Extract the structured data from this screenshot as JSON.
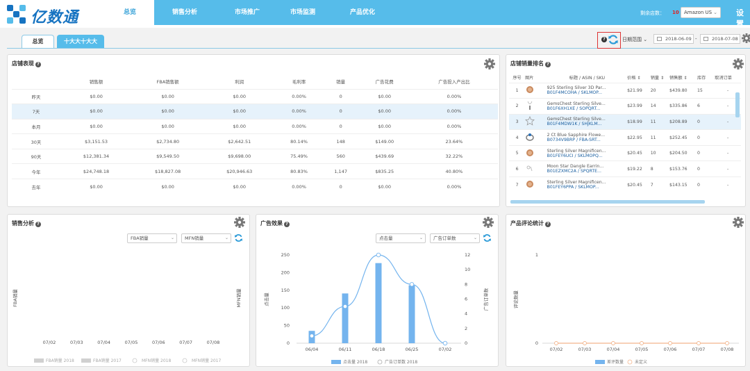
{
  "brand": {
    "name": "亿数通"
  },
  "nav": {
    "tabs": [
      "总览",
      "销售分析",
      "市场推广",
      "市场监测",
      "产品优化"
    ],
    "remaining_label": "剩余店数：",
    "remaining_count": "10",
    "store_selected": "Amazon US",
    "settings": "设置"
  },
  "subtabs": [
    "总览",
    "十大大十大大"
  ],
  "toolbar": {
    "help": "?",
    "date_range_label": "日期范围",
    "date_start": "2018-06-09",
    "date_end": "2018-07-08",
    "date_sep": "-"
  },
  "store_perf": {
    "title": "店铺表现",
    "columns": [
      "",
      "销售额",
      "FBA销售额",
      "利润",
      "毛利率",
      "销量",
      "广告花费",
      "广告投入产出比"
    ],
    "rows": [
      [
        "昨天",
        "$0.00",
        "$0.00",
        "$0.00",
        "0.00%",
        "0",
        "$0.00",
        "0.00%"
      ],
      [
        "7天",
        "$0.00",
        "$0.00",
        "$0.00",
        "0.00%",
        "0",
        "$0.00",
        "0.00%"
      ],
      [
        "本月",
        "$0.00",
        "$0.00",
        "$0.00",
        "0.00%",
        "0",
        "$0.00",
        "0.00%"
      ],
      [
        "30天",
        "$3,151.53",
        "$2,734.80",
        "$2,642.51",
        "80.14%",
        "148",
        "$149.00",
        "23.64%"
      ],
      [
        "90天",
        "$12,381.34",
        "$9,549.50",
        "$9,698.00",
        "75.49%",
        "560",
        "$439.69",
        "32.22%"
      ],
      [
        "今年",
        "$24,748.18",
        "$18,827.08",
        "$20,946.63",
        "80.83%",
        "1,147",
        "$835.25",
        "40.80%"
      ],
      [
        "去年",
        "$0.00",
        "$0.00",
        "$0.00",
        "0.00%",
        "0",
        "$0.00",
        "0.00%"
      ]
    ]
  },
  "rank": {
    "title": "店铺销量排名",
    "columns": [
      "序号",
      "图片",
      "标题 / ASIN / SKU",
      "价格 ⇕",
      "销量 ⇕",
      "销售额 ⇕",
      "库存",
      "取消订单"
    ],
    "rows": [
      {
        "n": "1",
        "title": "925 Sterling Silver 3D Par...",
        "sub": "B01F4MCOHA / SKLMOP...",
        "price": "$21.99",
        "qty": "20",
        "sales": "$439.80",
        "stock": "15",
        "cancel": "-",
        "stock_red": false,
        "icon": "pendant-icon"
      },
      {
        "n": "2",
        "title": "GemsChest Sterling Silve...",
        "sub": "B01F6XH1XE / SOPQRT...",
        "price": "$23.99",
        "qty": "14",
        "sales": "$335.86",
        "stock": "6",
        "cancel": "-",
        "stock_red": true,
        "icon": "necklace-icon"
      },
      {
        "n": "3",
        "title": "GemsChest Sterling Silve...",
        "sub": "B01F4MDW1K / SHJKLM...",
        "price": "$18.99",
        "qty": "11",
        "sales": "$208.89",
        "stock": "0",
        "cancel": "-",
        "stock_red": true,
        "icon": "star-pendant-icon"
      },
      {
        "n": "4",
        "title": "2 Ct Blue Sapphire Flowe...",
        "sub": "B0734V9BRP / FBA-SRT...",
        "price": "$22.95",
        "qty": "11",
        "sales": "$252.45",
        "stock": "0",
        "cancel": "-",
        "stock_red": true,
        "icon": "ring-icon"
      },
      {
        "n": "5",
        "title": "Sterling Silver Magnificen...",
        "sub": "B01FEY6UCI / SKLMOPQ...",
        "price": "$20.45",
        "qty": "10",
        "sales": "$204.50",
        "stock": "0",
        "cancel": "-",
        "stock_red": true,
        "icon": "pendant-icon"
      },
      {
        "n": "6",
        "title": "Moon Star Dangle Earrin...",
        "sub": "B01EZXMC2A / SPQRTE...",
        "price": "$19.22",
        "qty": "8",
        "sales": "$153.76",
        "stock": "0",
        "cancel": "-",
        "stock_red": true,
        "icon": "earring-icon"
      },
      {
        "n": "7",
        "title": "Sterling Silver Magnificen...",
        "sub": "B01FEY6PPA / SKLMOP...",
        "price": "$20.45",
        "qty": "7",
        "sales": "$143.15",
        "stock": "0",
        "cancel": "-",
        "stock_red": true,
        "icon": "pendant-icon"
      }
    ]
  },
  "sales_analysis": {
    "title": "销售分析",
    "select1": "FBA销量",
    "select2": "MFN销量",
    "chart_data": {
      "type": "bar",
      "categories": [
        "07/02",
        "07/03",
        "07/04",
        "07/05",
        "07/06",
        "07/07",
        "07/08"
      ],
      "ylabel_left": "FBA销量",
      "ylabel_right": "MFN销量",
      "series": [
        {
          "name": "FBA销量 2018",
          "values": [
            0,
            0,
            0,
            0,
            0,
            0,
            0
          ]
        },
        {
          "name": "FBA销量 2017",
          "values": [
            0,
            0,
            0,
            0,
            0,
            0,
            0
          ]
        },
        {
          "name": "MFN销量 2018",
          "values": [
            0,
            0,
            0,
            0,
            0,
            0,
            0
          ]
        },
        {
          "name": "MFN销量 2017",
          "values": [
            0,
            0,
            0,
            0,
            0,
            0,
            0
          ]
        }
      ]
    }
  },
  "ad_effect": {
    "title": "广告效果",
    "select1": "点击量",
    "select2": "广告订单数",
    "chart_data": {
      "type": "bar",
      "categories": [
        "06/04",
        "06/11",
        "06/18",
        "06/25",
        "07/02"
      ],
      "ylabel_left": "点击量",
      "ylabel_right": "广告订单数",
      "ylim_left": [
        0,
        250
      ],
      "yticks_left": [
        0,
        50,
        100,
        150,
        200,
        250
      ],
      "ylim_right": [
        0,
        12
      ],
      "yticks_right": [
        0,
        2,
        4,
        6,
        8,
        10,
        12
      ],
      "series": [
        {
          "name": "点击量 2018",
          "type": "bar",
          "axis": "left",
          "values": [
            35,
            141,
            227,
            164,
            0
          ],
          "color": "#74b4ee"
        },
        {
          "name": "广告订单数 2018",
          "type": "line",
          "axis": "right",
          "values": [
            1,
            5,
            12,
            8,
            0
          ],
          "color": "#74b4ee"
        }
      ]
    }
  },
  "reviews": {
    "title": "产品评论统计",
    "chart_data": {
      "type": "line",
      "categories": [
        "07/02",
        "07/03",
        "07/04",
        "07/05",
        "07/06",
        "07/07",
        "07/08"
      ],
      "ylabel": "评论数量",
      "ylim": [
        0,
        1
      ],
      "yticks": [
        0,
        1
      ],
      "series": [
        {
          "name": "差评数量",
          "type": "bar",
          "values": [
            0,
            0,
            0,
            0,
            0,
            0,
            0
          ],
          "color": "#74b4ee"
        },
        {
          "name": "未定义",
          "type": "line",
          "values": [
            0,
            0,
            0,
            0,
            0,
            0,
            0
          ],
          "color": "#f3b58c"
        }
      ]
    }
  },
  "colors": {
    "accent": "#56bcea",
    "brand": "#1673c1",
    "alert": "#e02020",
    "bar": "#74b4ee"
  }
}
